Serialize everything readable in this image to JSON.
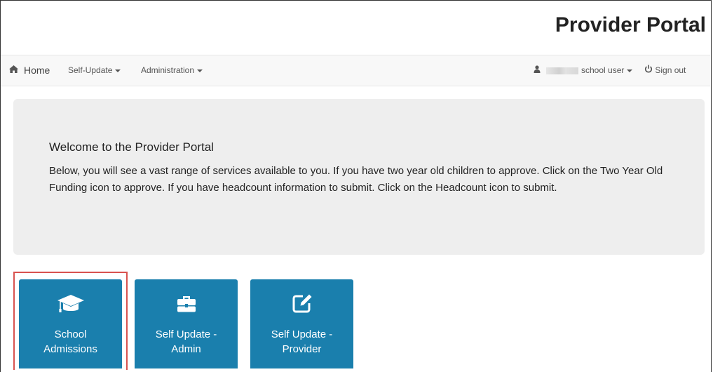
{
  "header": {
    "title": "Provider Portal"
  },
  "navbar": {
    "home_label": "Home",
    "self_update_label": "Self-Update",
    "administration_label": "Administration",
    "user_label": "school user",
    "sign_out_label": "Sign out",
    "icons": {
      "home": "home-icon",
      "user": "person-icon",
      "sign_out": "power-icon"
    }
  },
  "welcome": {
    "title": "Welcome to the Provider Portal",
    "body": "Below, you will see a vast range of services available to you. If you have two year old children to approve. Click on the Two Year Old Funding icon to approve. If you have headcount information to submit. Click on the Headcount icon to submit."
  },
  "tiles": [
    {
      "line1": "School",
      "line2": "Admissions",
      "icon": "graduation-cap-icon",
      "highlighted": true
    },
    {
      "line1": "Self Update -",
      "line2": "Admin",
      "icon": "briefcase-icon",
      "highlighted": false
    },
    {
      "line1": "Self Update -",
      "line2": "Provider",
      "icon": "edit-icon",
      "highlighted": false
    }
  ],
  "colors": {
    "tile_background": "#1a7fad",
    "highlight_border": "#d9534f",
    "navbar_background": "#f8f8f8",
    "jumbotron_background": "#eeeeee"
  }
}
